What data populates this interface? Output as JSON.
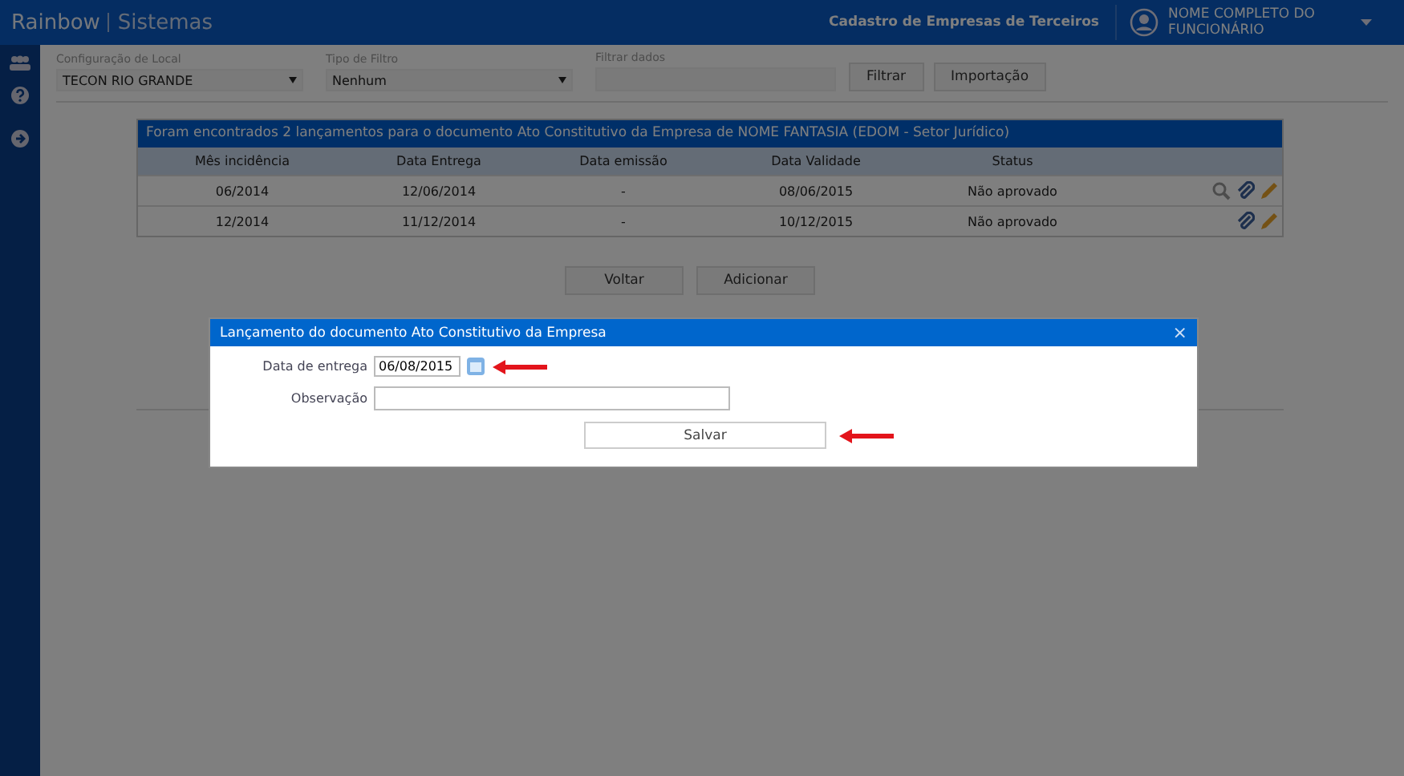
{
  "header": {
    "brand": "Rainbow",
    "product": "Sistemas",
    "page_title": "Cadastro de Empresas de Terceiros",
    "user_name": "NOME COMPLETO DO FUNCIONÁRIO"
  },
  "filters": [
    {
      "label": "Configuração de Local",
      "kind": "select",
      "value": "TECON RIO GRANDE"
    },
    {
      "label": "Tipo de Filtro",
      "kind": "select",
      "value": "Nenhum"
    },
    {
      "label": "Filtrar dados",
      "kind": "text"
    }
  ],
  "filter_buttons": [
    "Filtrar",
    "Importação"
  ],
  "table": {
    "caption": "Foram encontrados 2 lançamentos para o documento Ato Constitutivo da Empresa de NOME FANTASIA (EDOM - Setor Jurídico)",
    "columns": [
      "Mês incidência",
      "Data Entrega",
      "Data emissão",
      "Data Validade",
      "Status"
    ],
    "rows": [
      {
        "cells": [
          "06/2014",
          "12/06/2014",
          "-",
          "08/06/2015",
          "Não aprovado"
        ],
        "actions": [
          {
            "kind": "search"
          },
          {
            "kind": "attach"
          },
          {
            "kind": "edit"
          }
        ]
      },
      {
        "cells": [
          "12/2014",
          "11/12/2014",
          "-",
          "10/12/2015",
          "Não aprovado"
        ],
        "actions": [
          {
            "kind": "attach"
          },
          {
            "kind": "edit"
          }
        ]
      }
    ]
  },
  "page_buttons": [
    "Voltar",
    "Adicionar"
  ],
  "dialog": {
    "title": "Lançamento do documento Ato Constitutivo da Empresa",
    "close": "×",
    "fields": [
      {
        "label": "Data de entrega",
        "kind": "date",
        "value": "06/08/2015"
      },
      {
        "label": "Observação",
        "kind": "text"
      }
    ],
    "button": "Salvar"
  }
}
